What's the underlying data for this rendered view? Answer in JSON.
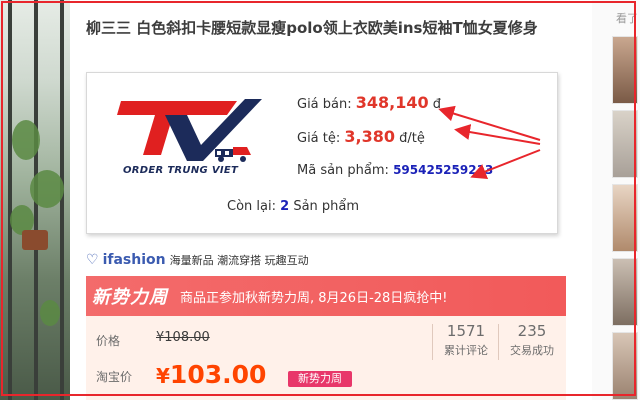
{
  "product": {
    "title": "柳三三 白色斜扣卡腰短款显瘦polo领上衣欧美ins短袖T恤女夏修身"
  },
  "order_box": {
    "logo_text": "ORDER TRUNG VIET",
    "price_label": "Giá bán:",
    "price_value": "348,140",
    "price_unit": "đ",
    "rate_label": "Giá tệ:",
    "rate_value": "3,380",
    "rate_unit": "đ/tệ",
    "code_label": "Mã sản phẩm:",
    "code_value": "595425259213",
    "stock_label": "Còn lại:",
    "stock_value": "2",
    "stock_unit": "Sản phẩm"
  },
  "ifashion": {
    "brand": "ifashion",
    "tags": "海量新品 潮流穿搭 玩趣互动"
  },
  "promo": {
    "logo": "新势力周",
    "text": "商品正参加秋新势力周, 8月26日-28日疯抢中!"
  },
  "price_panel": {
    "original_label": "价格",
    "original_price": "¥108.00",
    "taobao_label": "淘宝价",
    "currency": "¥",
    "sale_price": "103.00",
    "badge": "新势力周",
    "reviews_count": "1571",
    "reviews_label": "累计评论",
    "sales_count": "235",
    "sales_label": "交易成功"
  },
  "right_column": {
    "label": "看了"
  },
  "colors": {
    "frame_red": "#e8262c",
    "price_red": "#e0362a",
    "code_blue": "#1b22b8",
    "promo_pink": "#f36b6b",
    "taobao_orange": "#ff4400",
    "badge_pink": "#e8376a",
    "logo_red": "#e02020",
    "logo_navy": "#1c2b5a"
  }
}
